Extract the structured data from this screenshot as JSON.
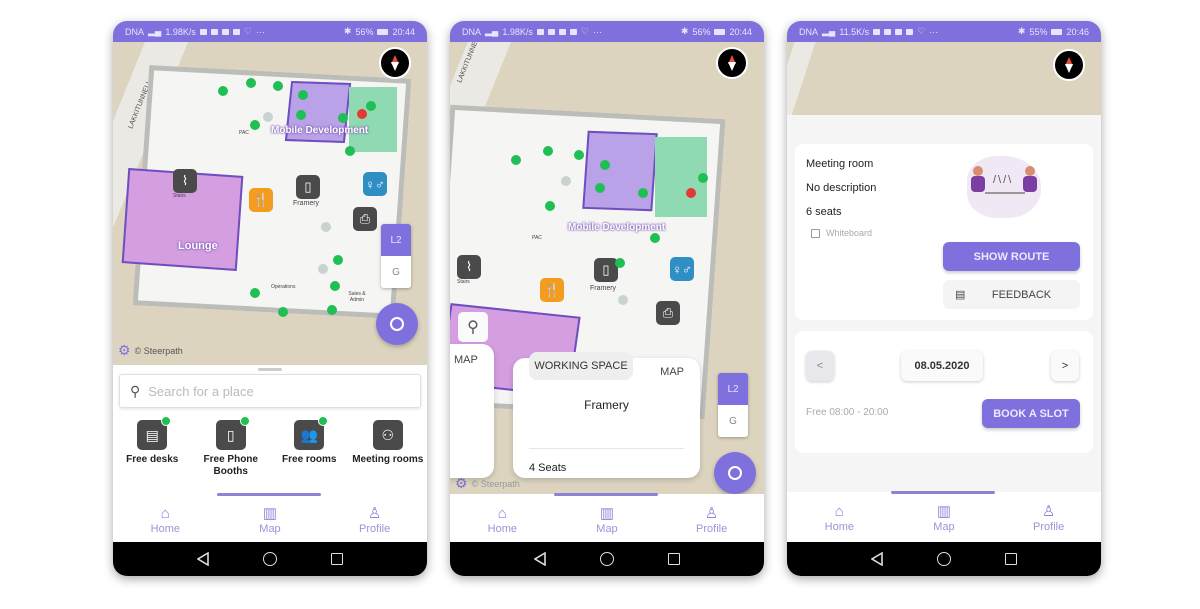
{
  "colors": {
    "accent": "#7e70dd",
    "free": "#1fbf53",
    "occupied": "#e53935",
    "map_bg": "#dcd4bf"
  },
  "screens": [
    {
      "status": {
        "carrier": "DNA",
        "speed": "1.98K/s",
        "battery": "56%",
        "time": "20:44"
      },
      "map": {
        "street_label": "LAKKITUNNELI",
        "rooms": {
          "mobile_dev": "Mobile Development",
          "lounge": "Lounge",
          "operations": "Operations",
          "sales": "Sales & Admin",
          "framery": "Framery",
          "stairs": "Stairs",
          "pac": "PAC"
        },
        "levels": [
          "L2",
          "G"
        ],
        "active_level": "L2",
        "copyright": "© Steerpath"
      },
      "search": {
        "placeholder": "Search for a place"
      },
      "categories": [
        {
          "icon": "desk-icon",
          "label": "Free desks",
          "badge": true
        },
        {
          "icon": "phone-booth-icon",
          "label": "Free Phone Booths",
          "badge": true
        },
        {
          "icon": "rooms-icon",
          "label": "Free rooms",
          "badge": true
        },
        {
          "icon": "meeting-room-icon",
          "label": "Meeting rooms",
          "badge": false
        }
      ]
    },
    {
      "status": {
        "carrier": "DNA",
        "speed": "1.98K/s",
        "battery": "56%",
        "time": "20:44"
      },
      "map": {
        "street_label": "LAKKITUNNELI",
        "rooms": {
          "mobile_dev": "Mobile Development",
          "framery": "Framery",
          "stairs": "Stairs",
          "pac": "PAC"
        },
        "levels": [
          "L2",
          "G"
        ],
        "active_level": "L2",
        "copyright": "© Steerpath"
      },
      "cards": {
        "left_action": "MAP",
        "main": {
          "tag": "WORKING SPACE",
          "action": "MAP",
          "title": "Framery",
          "seats": "4 Seats"
        }
      }
    },
    {
      "status": {
        "carrier": "DNA",
        "speed": "11.5K/s",
        "battery": "55%",
        "time": "20:46"
      },
      "details": {
        "type": "Meeting room",
        "description": "No description",
        "seats": "6 seats",
        "amenity": "Whiteboard",
        "show_route": "SHOW ROUTE",
        "feedback": "FEEDBACK"
      },
      "booking": {
        "prev": "<",
        "date": "08.05.2020",
        "next": ">",
        "availability": "Free 08:00 - 20:00",
        "book": "BOOK A SLOT"
      }
    }
  ],
  "nav": {
    "items": [
      {
        "label": "Home",
        "icon": "home-icon"
      },
      {
        "label": "Map",
        "icon": "map-icon"
      },
      {
        "label": "Profile",
        "icon": "profile-icon"
      }
    ],
    "active": "Map"
  }
}
